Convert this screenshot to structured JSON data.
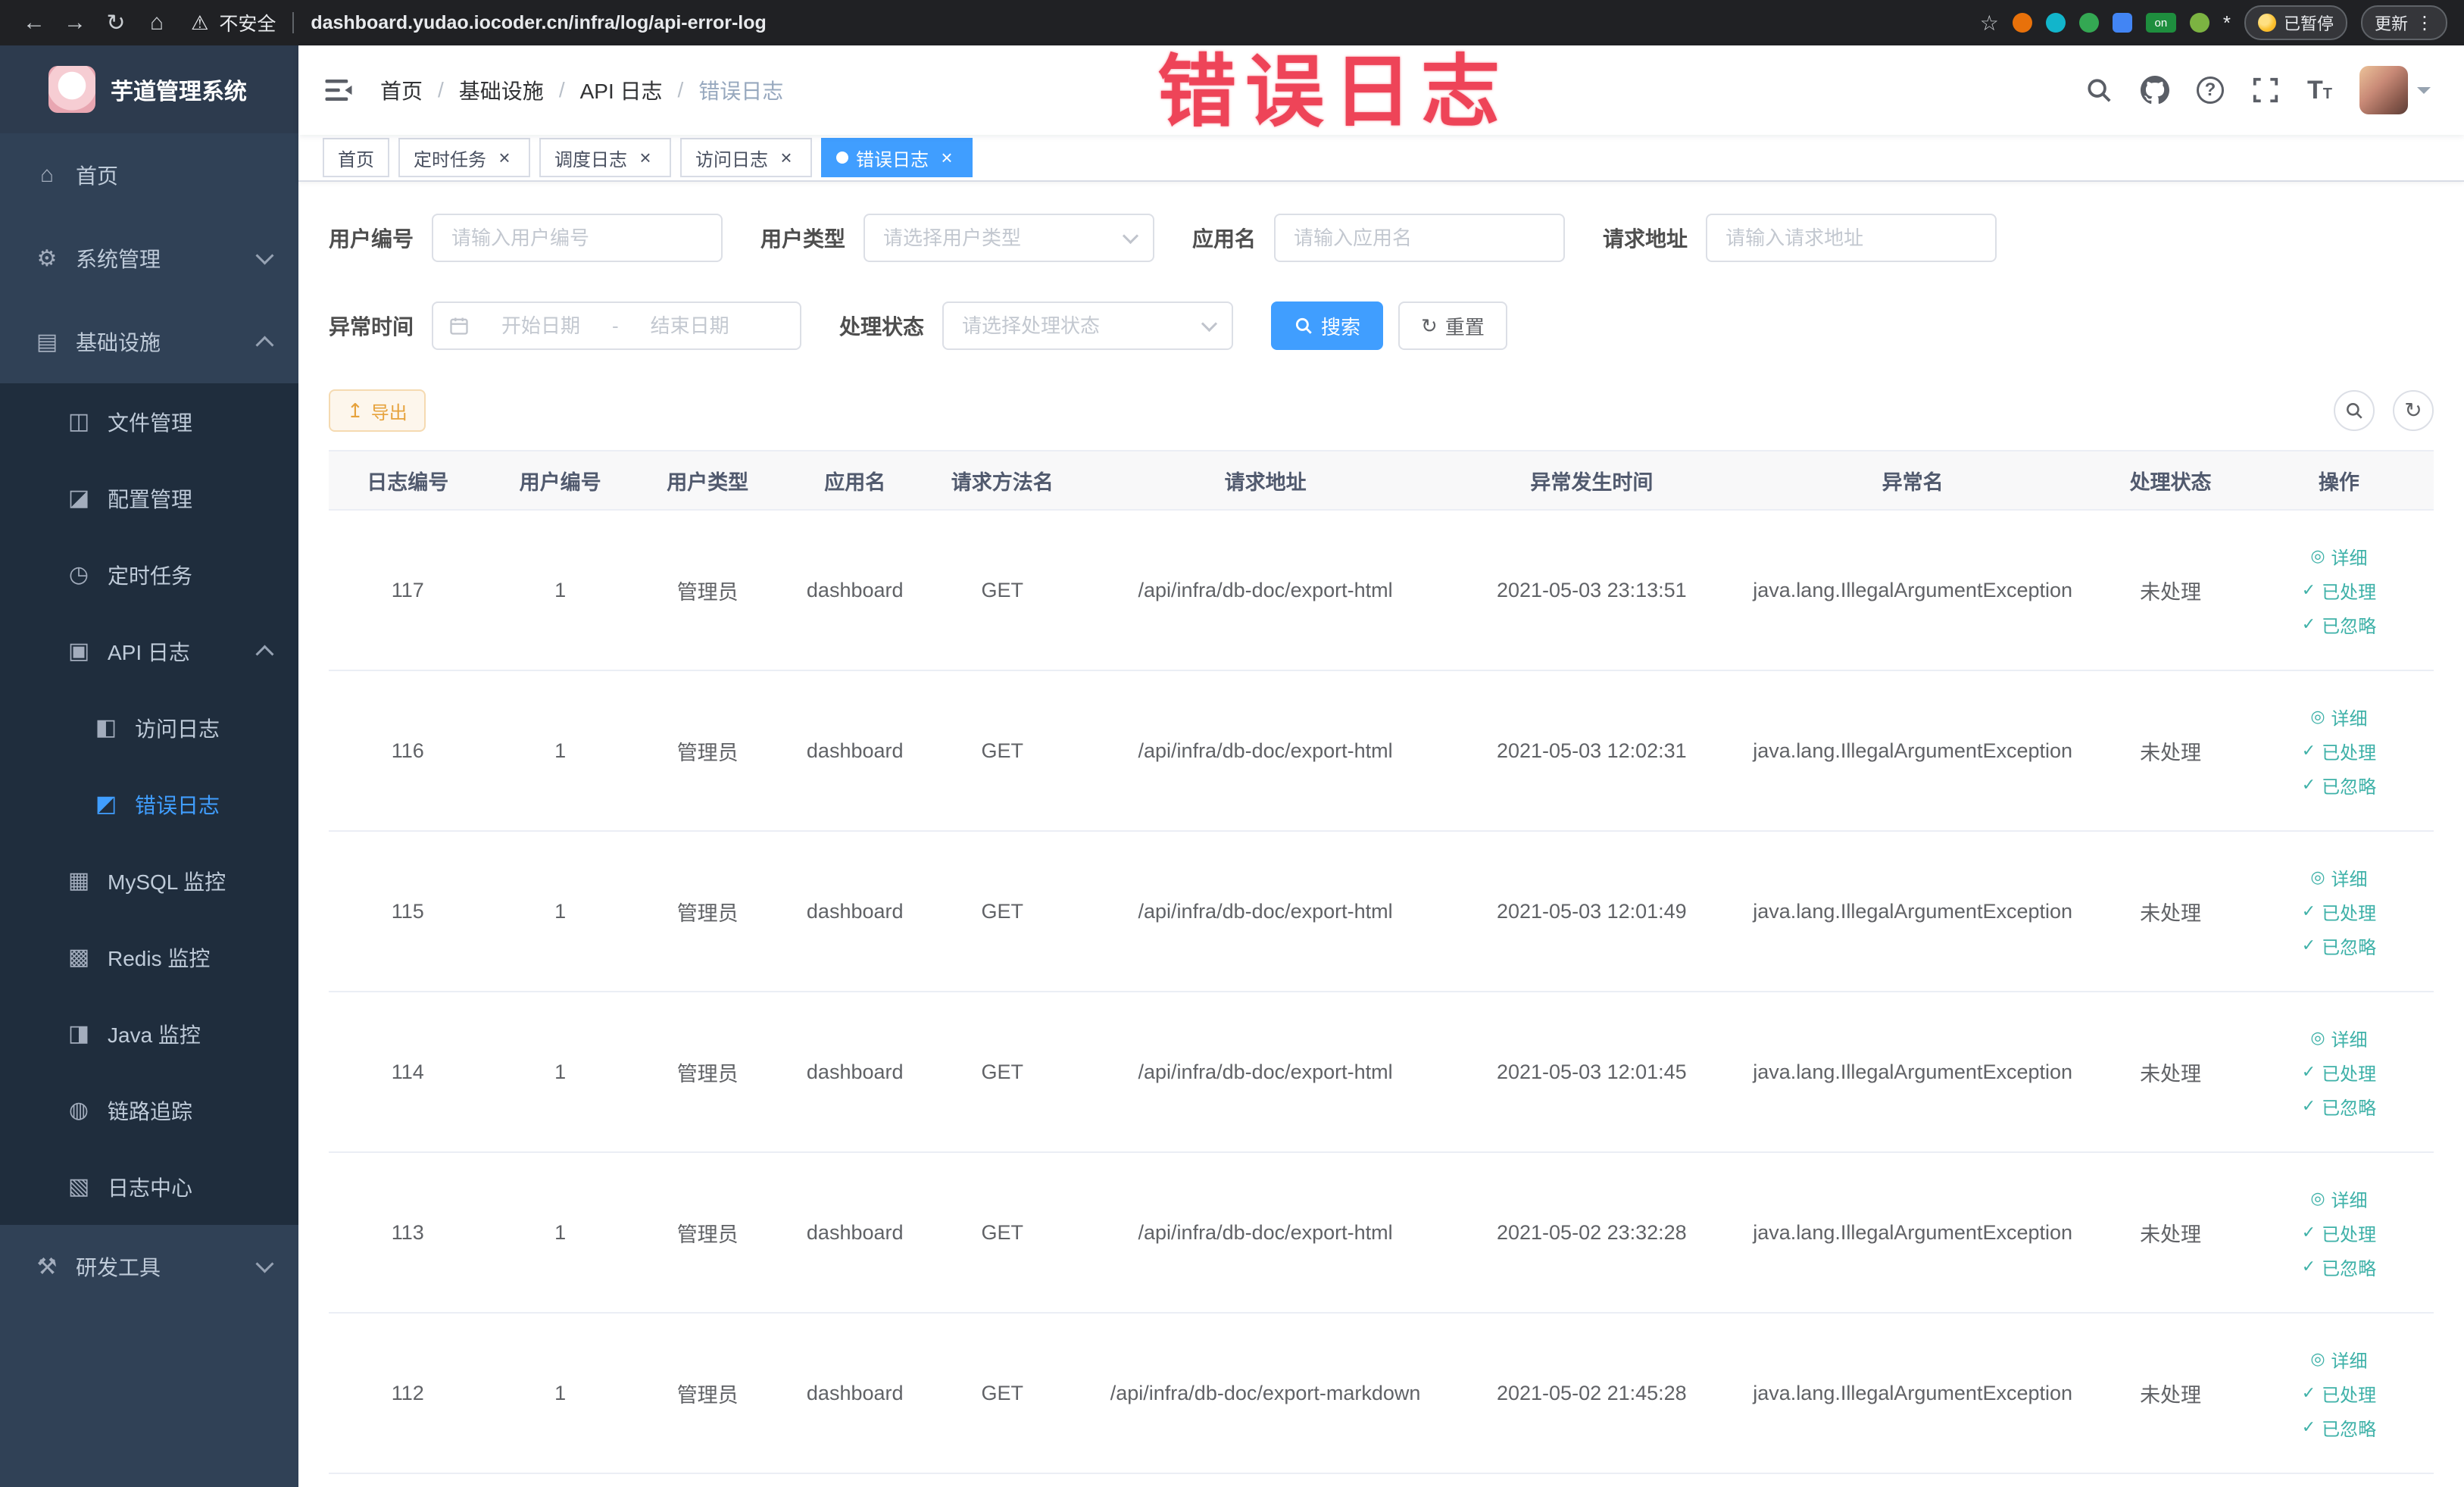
{
  "browser": {
    "security_label": "不安全",
    "url": "dashboard.yudao.iocoder.cn/infra/log/api-error-log",
    "on_badge": "on",
    "paused_label": "已暂停",
    "update_label": "更新"
  },
  "icons": {
    "back": "←",
    "forward": "→",
    "reload": "↻",
    "home": "⌂",
    "warning": "⚠",
    "star": "☆",
    "ext_star": "*",
    "kebab": "⋮",
    "question": "?",
    "font_size": "T",
    "close": "×",
    "eye": "◎",
    "check": "✓",
    "export": "↥",
    "refresh": "↻"
  },
  "watermark": "错误日志",
  "sidebar": {
    "logo_title": "芋道管理系统",
    "items": [
      {
        "label": "首页",
        "icon": "⌂"
      },
      {
        "label": "系统管理",
        "icon": "⚙"
      },
      {
        "label": "基础设施",
        "icon": "▤"
      },
      {
        "label": "文件管理",
        "icon": "◫"
      },
      {
        "label": "配置管理",
        "icon": "◪"
      },
      {
        "label": "定时任务",
        "icon": "◷"
      },
      {
        "label": "API 日志",
        "icon": "▣"
      },
      {
        "label": "访问日志",
        "icon": "◧"
      },
      {
        "label": "错误日志",
        "icon": "◩"
      },
      {
        "label": "MySQL 监控",
        "icon": "▦"
      },
      {
        "label": "Redis 监控",
        "icon": "▩"
      },
      {
        "label": "Java 监控",
        "icon": "◨"
      },
      {
        "label": "链路追踪",
        "icon": "◍"
      },
      {
        "label": "日志中心",
        "icon": "▧"
      },
      {
        "label": "研发工具",
        "icon": "⚒"
      }
    ]
  },
  "breadcrumb": {
    "separator": "/",
    "items": [
      "首页",
      "基础设施",
      "API 日志",
      "错误日志"
    ]
  },
  "tabs": [
    {
      "label": "首页"
    },
    {
      "label": "定时任务"
    },
    {
      "label": "调度日志"
    },
    {
      "label": "访问日志"
    },
    {
      "label": "错误日志"
    }
  ],
  "filters": {
    "user_id_label": "用户编号",
    "user_id_placeholder": "请输入用户编号",
    "user_type_label": "用户类型",
    "user_type_placeholder": "请选择用户类型",
    "app_name_label": "应用名",
    "app_name_placeholder": "请输入应用名",
    "request_url_label": "请求地址",
    "request_url_placeholder": "请输入请求地址",
    "exception_time_label": "异常时间",
    "date_start_placeholder": "开始日期",
    "date_separator": "-",
    "date_end_placeholder": "结束日期",
    "process_status_label": "处理状态",
    "process_status_placeholder": "请选择处理状态",
    "search_label": "搜索",
    "reset_label": "重置"
  },
  "toolbar": {
    "export_label": "导出"
  },
  "table": {
    "columns": [
      "日志编号",
      "用户编号",
      "用户类型",
      "应用名",
      "请求方法名",
      "请求地址",
      "异常发生时间",
      "异常名",
      "处理状态",
      "操作"
    ],
    "action_labels": {
      "detail": "详细",
      "processed": "已处理",
      "ignored": "已忽略"
    },
    "rows": [
      {
        "id": "117",
        "user_id": "1",
        "user_type": "管理员",
        "app_name": "dashboard",
        "method": "GET",
        "url": "/api/infra/db-doc/export-html",
        "time": "2021-05-03 23:13:51",
        "exception": "java.lang.IllegalArgumentException",
        "status": "未处理"
      },
      {
        "id": "116",
        "user_id": "1",
        "user_type": "管理员",
        "app_name": "dashboard",
        "method": "GET",
        "url": "/api/infra/db-doc/export-html",
        "time": "2021-05-03 12:02:31",
        "exception": "java.lang.IllegalArgumentException",
        "status": "未处理"
      },
      {
        "id": "115",
        "user_id": "1",
        "user_type": "管理员",
        "app_name": "dashboard",
        "method": "GET",
        "url": "/api/infra/db-doc/export-html",
        "time": "2021-05-03 12:01:49",
        "exception": "java.lang.IllegalArgumentException",
        "status": "未处理"
      },
      {
        "id": "114",
        "user_id": "1",
        "user_type": "管理员",
        "app_name": "dashboard",
        "method": "GET",
        "url": "/api/infra/db-doc/export-html",
        "time": "2021-05-03 12:01:45",
        "exception": "java.lang.IllegalArgumentException",
        "status": "未处理"
      },
      {
        "id": "113",
        "user_id": "1",
        "user_type": "管理员",
        "app_name": "dashboard",
        "method": "GET",
        "url": "/api/infra/db-doc/export-html",
        "time": "2021-05-02 23:32:28",
        "exception": "java.lang.IllegalArgumentException",
        "status": "未处理"
      },
      {
        "id": "112",
        "user_id": "1",
        "user_type": "管理员",
        "app_name": "dashboard",
        "method": "GET",
        "url": "/api/infra/db-doc/export-markdown",
        "time": "2021-05-02 21:45:28",
        "exception": "java.lang.IllegalArgumentException",
        "status": "未处理"
      }
    ]
  },
  "colors": {
    "primary": "#409eff",
    "action_link": "#3eb1a8",
    "warning_text": "#e6a23c",
    "warning_bg": "#fdf6ec",
    "warning_border": "#f5dab1",
    "sidebar_bg": "#304156",
    "submenu_bg": "#1f2d3d",
    "active_tab_bg": "#409eff",
    "watermark": "#ee4458",
    "chrome_bg": "#202124"
  }
}
